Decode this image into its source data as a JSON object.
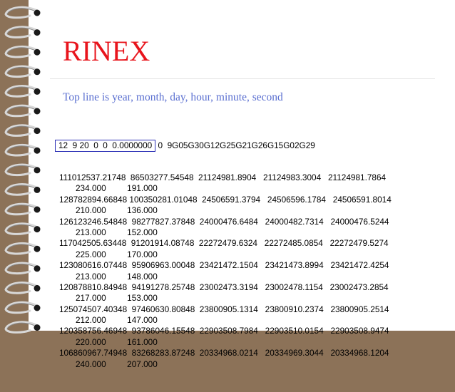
{
  "slide": {
    "title": "RINEX",
    "subtitle": "Top line is year, month, day, hour, minute, second",
    "header_line": {
      "boxed": "12  9 20  0  0  0.0000000",
      "rest": " 0  9G05G30G12G25G21G26G15G02G29"
    },
    "data_lines": [
      "111012537.21748  86503277.54548  21124981.8904   21124983.3004   21124981.7864",
      "234.000         191.000",
      "128782894.66848 100350281.01048  24506591.3794   24506596.1784   24506591.8014",
      "210.000         136.000",
      "126123246.54848  98277827.37848  24000476.6484   24000482.7314   24000476.5244",
      "213.000         152.000",
      "117042505.63448  91201914.08748  22272479.6324   22272485.0854   22272479.5274",
      "225.000         170.000",
      "123080616.07448  95906963.00048  23421472.1504   23421473.8994   23421472.4254",
      "213.000         148.000",
      "120878810.84948  94191278.25748  23002473.3194   23002478.1154   23002473.2854",
      "217.000         153.000",
      "125074507.40348  97460630.80848  23800905.1314   23800910.2374   23800905.2514",
      "212.000         147.000",
      "120358756.46948  93786046.15548  22903508.7984   22903510.0154   22903508.9474",
      "220.000         161.000",
      "106860967.74948  83268283.87248  20334968.0214   20334969.3044   20334968.1204",
      "240.000         207.000"
    ]
  },
  "colors": {
    "title": "#e8141c",
    "subtitle": "#5a6fd0",
    "box": "#2a2fb5",
    "frame": "#8c7258"
  }
}
